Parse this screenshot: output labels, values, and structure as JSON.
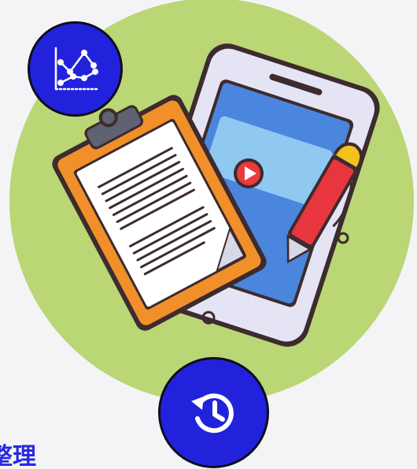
{
  "caption": {
    "text": "整理"
  },
  "icons": {
    "chart_badge": "line-chart-icon",
    "history_badge": "history-clock-icon",
    "illustration": "clipboard-phone-pen-illustration"
  },
  "colors": {
    "background": "#f4f4f6",
    "circle": "#bad675",
    "badge": "#2222dd",
    "caption": "#2828e0"
  }
}
